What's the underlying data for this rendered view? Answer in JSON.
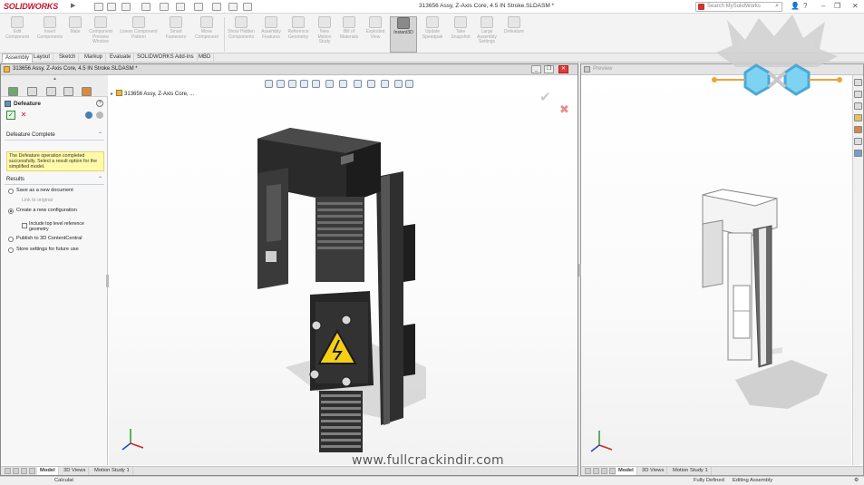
{
  "app": {
    "logo_text": "SOLIDWORKS",
    "document_title": "313656 Assy, Z-Axis Core, 4.5 IN Stroke.SLDASM *",
    "search_placeholder": "Search MySolidWorks"
  },
  "ribbon": {
    "buttons": [
      {
        "label": "Edit Component",
        "active": false
      },
      {
        "label": "Insert Components",
        "active": false
      },
      {
        "label": "Mate",
        "active": false
      },
      {
        "label": "Component Preview Window",
        "active": false
      },
      {
        "label": "Linear Component Pattern",
        "active": false
      },
      {
        "label": "Smart Fasteners",
        "active": false
      },
      {
        "label": "Move Component",
        "active": false
      },
      {
        "label": "Show Hidden Components",
        "active": false
      },
      {
        "label": "Assembly Features",
        "active": false
      },
      {
        "label": "Reference Geometry",
        "active": false
      },
      {
        "label": "New Motion Study",
        "active": false
      },
      {
        "label": "Bill of Materials",
        "active": false
      },
      {
        "label": "Exploded View",
        "active": false
      },
      {
        "label": "Instant3D",
        "active": true
      },
      {
        "label": "Update Speedpak",
        "active": false
      },
      {
        "label": "Take Snapshot",
        "active": false
      },
      {
        "label": "Large Assembly Settings",
        "active": false
      },
      {
        "label": "Defeature",
        "active": false
      }
    ]
  },
  "command_tabs": [
    "Assembly",
    "Layout",
    "Sketch",
    "Markup",
    "Evaluate",
    "SOLIDWORKS Add-Ins",
    "MBD"
  ],
  "left_window": {
    "title": "313656 Assy, Z-Axis Core, 4.5 IN Stroke.SLDASM *",
    "tree_item": "313656 Assy, Z-Axis Core, ...",
    "bottom_tabs": [
      "Model",
      "3D Views",
      "Motion Study 1"
    ],
    "active_tab": "Model"
  },
  "property_manager": {
    "title": "Defeature",
    "section_complete": "Defeature Complete",
    "message": "The Defeature operation completed successfully. Select a result option for the simplified model.",
    "section_results": "Results",
    "options": [
      {
        "label": "Save as a new document",
        "selected": false
      },
      {
        "label": "Create a new configuration",
        "selected": true
      },
      {
        "label": "Publish to 3D ContentCentral",
        "selected": false
      },
      {
        "label": "Store settings for future use",
        "selected": false
      }
    ],
    "link_to_original": "Link to original",
    "include_reference": "Include top level reference geometry"
  },
  "right_window": {
    "title": "Preview",
    "bottom_tabs": [
      "Model",
      "3D Views",
      "Motion Study 1"
    ],
    "active_tab": "Model"
  },
  "watermark": "www.fullcrackindir.com",
  "statusbar": {
    "left": "Calculat",
    "state": "Fully Defined",
    "mode": "Editing Assembly"
  },
  "colors": {
    "brand_red": "#c8102e",
    "message_bg": "#fffaa8",
    "model_black": "#262626",
    "hazard_yellow": "#f4cf16"
  }
}
